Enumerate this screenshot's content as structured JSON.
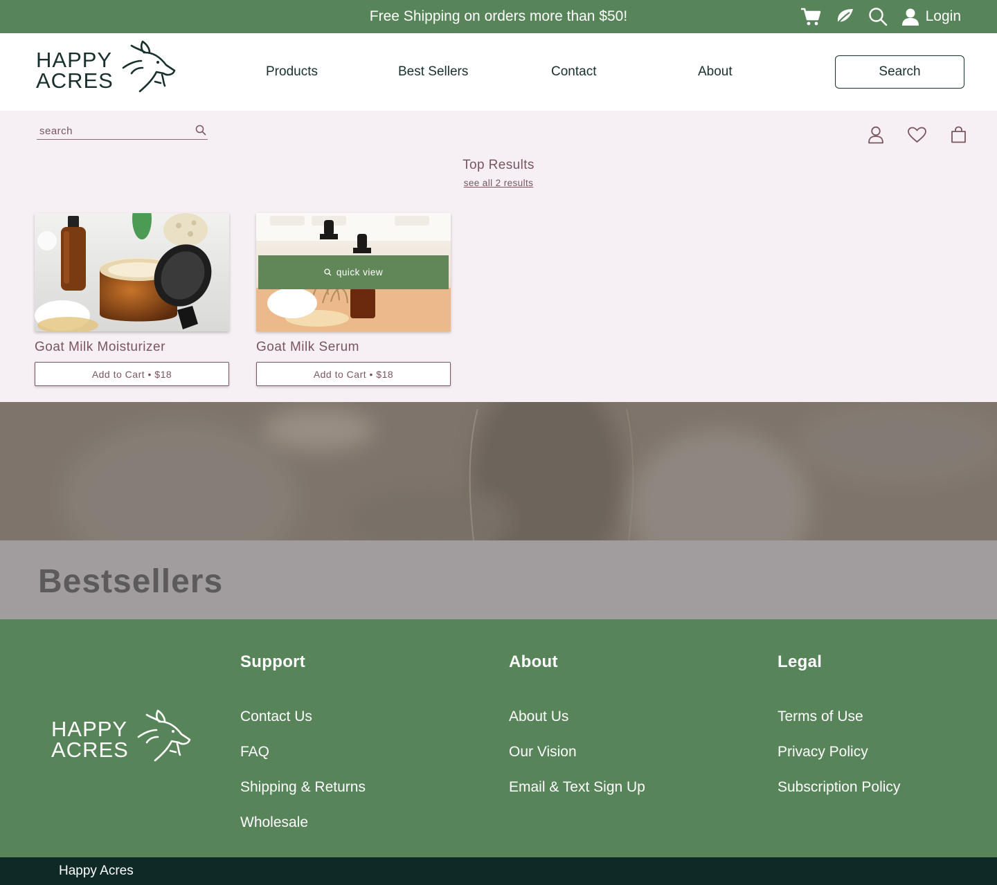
{
  "topbar": {
    "promo": "Free Shipping on orders more than $50!",
    "icons": [
      "cart-icon",
      "leaf-icon",
      "search-icon",
      "user-icon"
    ],
    "login_label": "Login",
    "background": "#58845a"
  },
  "header": {
    "logo_line1": "HAPPY",
    "logo_line2": "ACRES",
    "nav": [
      {
        "label": "Products"
      },
      {
        "label": "Best Sellers"
      },
      {
        "label": "Contact"
      },
      {
        "label": "About"
      }
    ],
    "search_button": "Search"
  },
  "search_panel": {
    "placeholder": "search",
    "icons": [
      "account-icon",
      "heart-icon",
      "bag-icon"
    ],
    "heading": "Top Results",
    "see_all": "see all 2 results",
    "background": "#f6eff3",
    "products": [
      {
        "name": "Goat Milk Moisturizer",
        "cart_label": "Add to Cart  •  $18"
      },
      {
        "name": "Goat Milk Serum",
        "cart_label": "Add to Cart  •  $18",
        "quick_view": "quick view"
      }
    ]
  },
  "bestsellers": {
    "title": "Bestsellers"
  },
  "footer": {
    "logo_line1": "HAPPY",
    "logo_line2": "ACRES",
    "columns": [
      {
        "heading": "Support",
        "links": [
          "Contact Us",
          "FAQ",
          "Shipping & Returns",
          "Wholesale"
        ]
      },
      {
        "heading": "About",
        "links": [
          "About Us",
          "Our Vision",
          "Email & Text Sign Up"
        ]
      },
      {
        "heading": "Legal",
        "links": [
          "Terms of Use",
          "Privacy Policy",
          "Subscription Policy"
        ]
      }
    ],
    "copyright": "Happy Acres",
    "background": "#58845a",
    "bottom_background": "#0f2a26"
  }
}
